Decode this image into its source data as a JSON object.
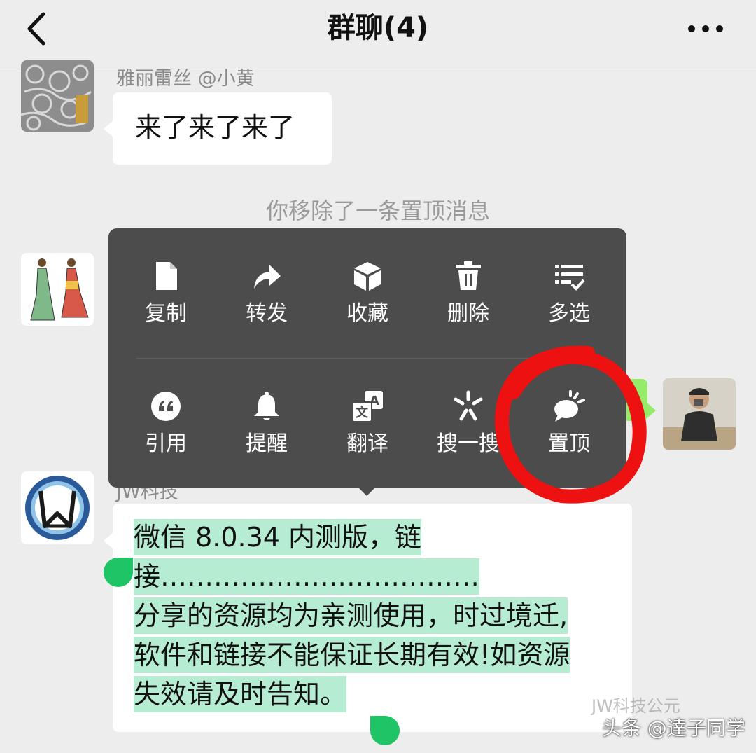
{
  "header": {
    "title": "群聊(4)",
    "back_icon": "chevron-left-icon",
    "more_icon": "more-dots-icon"
  },
  "messages": [
    {
      "sender": "雅丽雷丝 @小黄",
      "text": "来了来了来了"
    },
    {
      "sender": "JW科技",
      "text": "微信 8.0.34 内测版，链接……………………………分享的资源均为亲测使用，时过境迁,软件和链接不能保证长期有效!如资源失效请及时告知。"
    }
  ],
  "selected_lines": [
    "微信 8.0.34 内测版，链",
    "接………………………………",
    "分享的资源均为亲测使用，时过境迁,",
    "软件和链接不能保证长期有效!如资源",
    "失效请及时告知。"
  ],
  "system_notice": "你移除了一条置顶消息",
  "context_menu": {
    "row1": [
      {
        "label": "复制",
        "icon": "copy-icon"
      },
      {
        "label": "转发",
        "icon": "forward-icon"
      },
      {
        "label": "收藏",
        "icon": "favorite-box-icon"
      },
      {
        "label": "删除",
        "icon": "trash-icon"
      },
      {
        "label": "多选",
        "icon": "multi-select-icon"
      }
    ],
    "row2": [
      {
        "label": "引用",
        "icon": "quote-icon"
      },
      {
        "label": "提醒",
        "icon": "bell-icon"
      },
      {
        "label": "翻译",
        "icon": "translate-icon"
      },
      {
        "label": "搜一搜",
        "icon": "search-spark-icon"
      },
      {
        "label": "置顶",
        "icon": "pin-top-icon"
      }
    ]
  },
  "watermark": {
    "text": "头条 @逹子同学",
    "background_text": "JW科技公元"
  },
  "colors": {
    "background": "#ededed",
    "menu_bg": "#4c4c4c",
    "selection": "#b5ecd2",
    "handle": "#1fc467",
    "annotation": "#ee1111"
  }
}
